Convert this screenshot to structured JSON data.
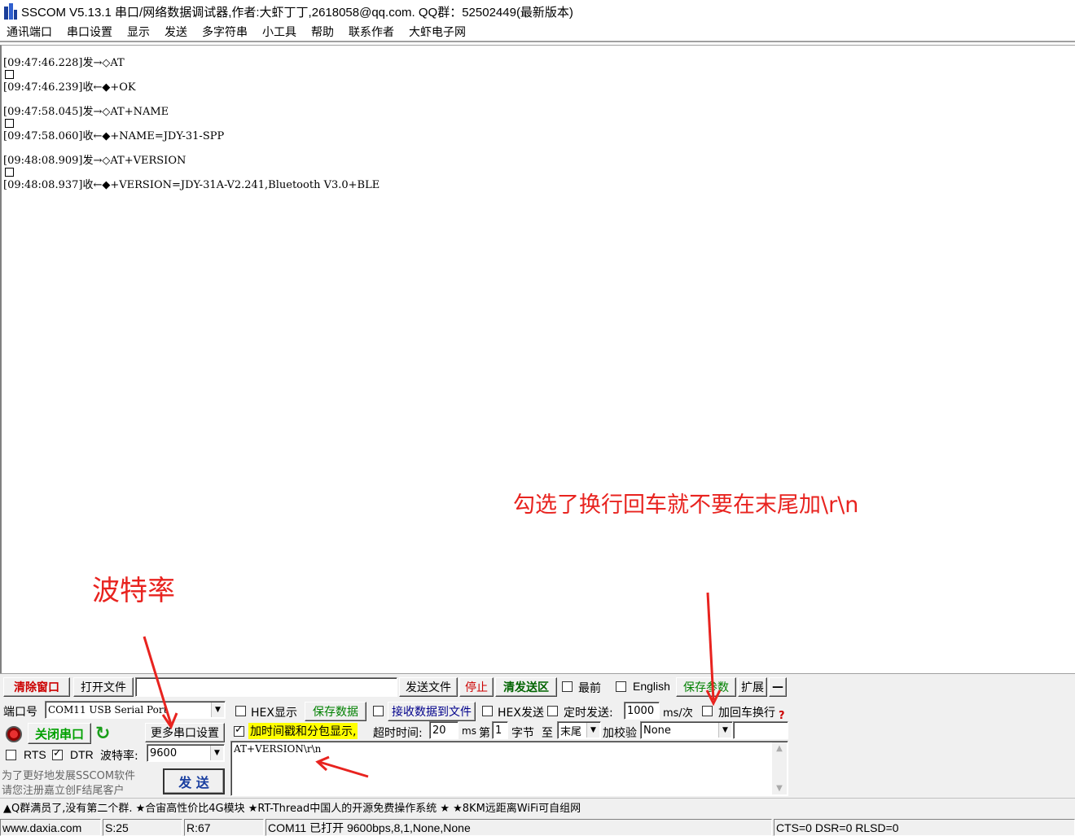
{
  "window": {
    "title": "SSCOM V5.13.1 串口/网络数据调试器,作者:大虾丁丁,2618058@qq.com. QQ群：52502449(最新版本)"
  },
  "menu": [
    "通讯端口",
    "串口设置",
    "显示",
    "发送",
    "多字符串",
    "小工具",
    "帮助",
    "联系作者",
    "大虾电子网"
  ],
  "log": [
    "[09:47:46.228]发→◇AT",
    "[09:47:46.239]收←◆+OK",
    "[09:47:58.045]发→◇AT+NAME",
    "[09:47:58.060]收←◆+NAME=JDY-31-SPP",
    "[09:48:08.909]发→◇AT+VERSION",
    "[09:48:08.937]收←◆+VERSION=JDY-31A-V2.241,Bluetooth V3.0+BLE"
  ],
  "annotations": {
    "crlf_note": "勾选了换行回车就不要在末尾加\\r\\n",
    "baud_note": "波特率"
  },
  "toolbar": {
    "clear_window": "清除窗口",
    "open_file": "打开文件",
    "file_path": "",
    "send_file": "发送文件",
    "stop": "停止",
    "clear_send": "清发送区",
    "topmost": "最前",
    "english": "English",
    "save_params": "保存参数",
    "expand": "扩展",
    "collapse": "—"
  },
  "port": {
    "port_label": "端口号",
    "port_value": "COM11 USB Serial Port",
    "close_port": "关闭串口",
    "more_settings": "更多串口设置",
    "rts": "RTS",
    "dtr": "DTR",
    "baud_label": "波特率:",
    "baud_value": "9600",
    "promo1": "为了更好地发展SSCOM软件",
    "promo2": "请您注册嘉立创F结尾客户"
  },
  "options": {
    "hex_display": "HEX显示",
    "save_data": "保存数据",
    "recv_to_file": "接收数据到文件",
    "hex_send": "HEX发送",
    "timed_send": "定时发送:",
    "interval": "1000",
    "interval_unit": "ms/次",
    "add_crlf": "加回车换行",
    "timestamp": "加时间戳和分包显示,",
    "timeout_label": "超时时间:",
    "timeout": "20",
    "ms": "ms",
    "byte_from_label": "第",
    "byte_from": "1",
    "byte_label": "字节",
    "to_label": "至",
    "to_value": "末尾",
    "checksum_label": "加校验",
    "checksum_value": "None",
    "help": "?"
  },
  "send": {
    "text": "AT+VERSION\\r\\n",
    "send_button": "发  送"
  },
  "ticker": "▲Q群满员了,没有第二个群. ★合宙高性价比4G模块 ★RT-Thread中国人的开源免费操作系统 ★ ★8KM远距离WiFi可自组网",
  "status": {
    "site": "www.daxia.com",
    "sent": "S:25",
    "recv": "R:67",
    "port_state": "COM11 已打开  9600bps,8,1,None,None",
    "lines": "CTS=0 DSR=0 RLSD=0"
  },
  "colors": {
    "annotation": "#e8231f",
    "highlight_yellow": "#ffff00",
    "save_green": "#008000"
  }
}
